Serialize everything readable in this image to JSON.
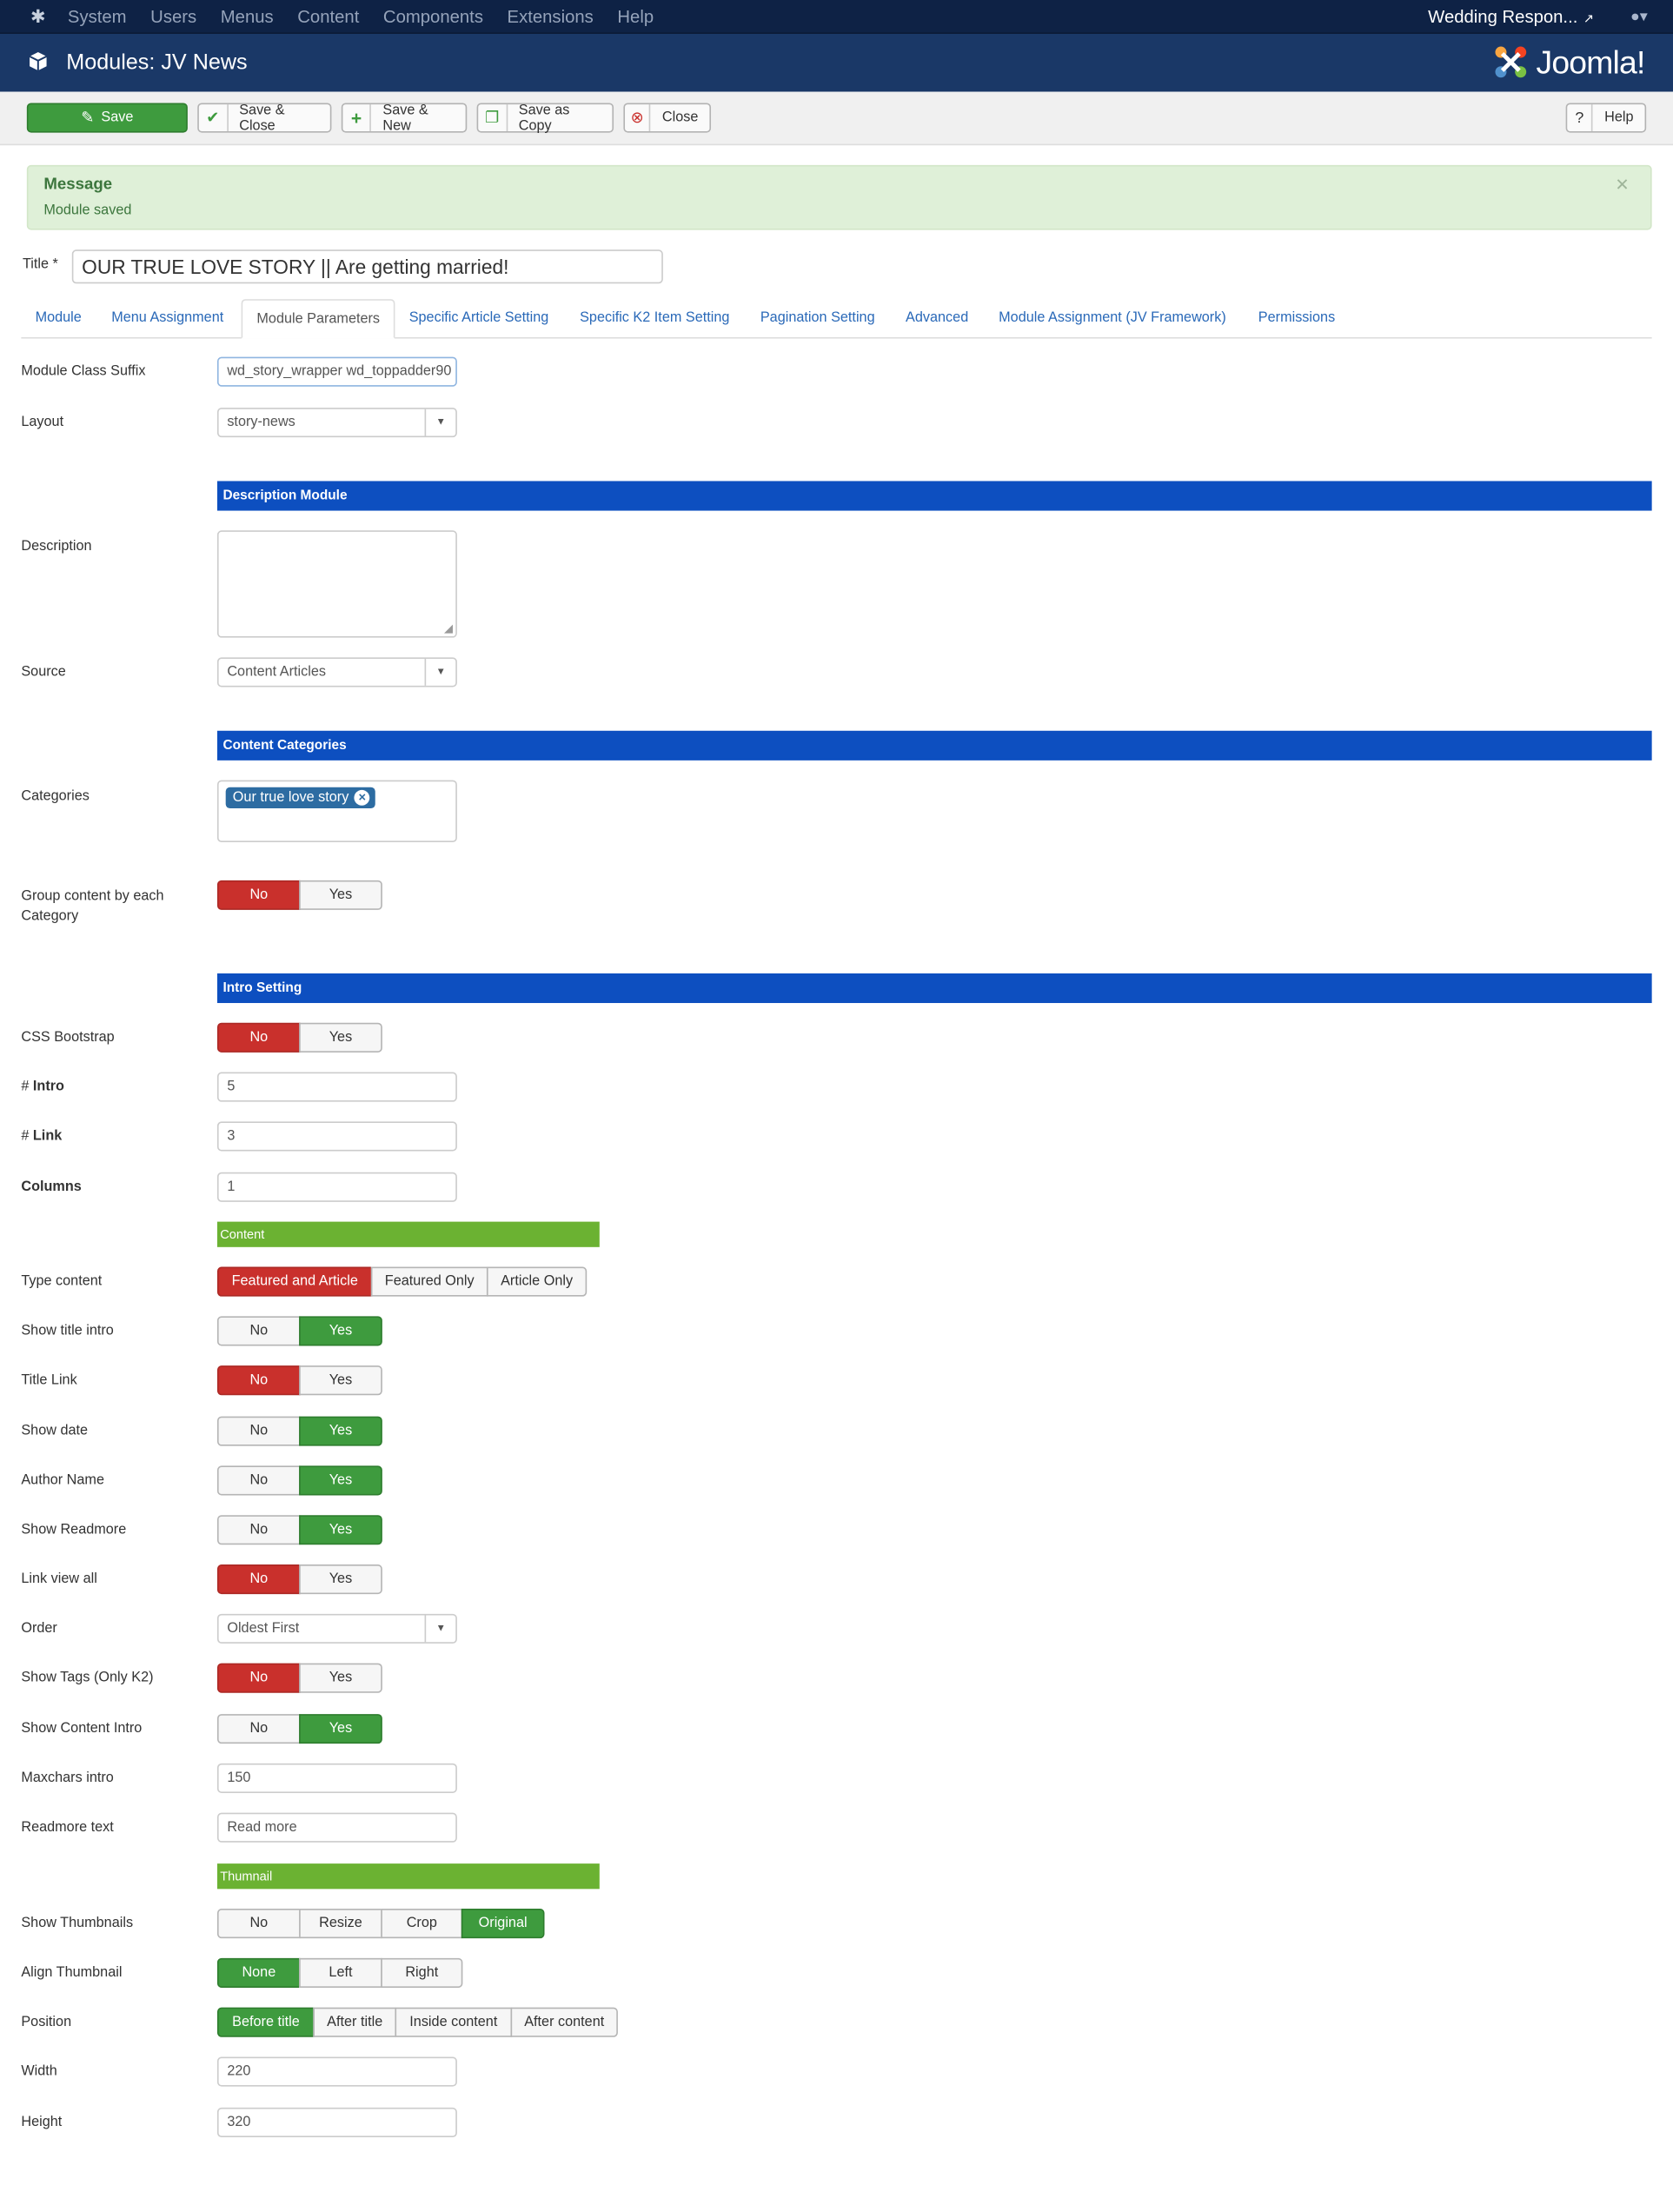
{
  "topnav": {
    "menu": [
      "System",
      "Users",
      "Menus",
      "Content",
      "Components",
      "Extensions",
      "Help"
    ],
    "site_name": "Wedding Respon...",
    "logo": "joomla-icon",
    "user_icon": "user-icon"
  },
  "header": {
    "title": "Modules: JV News",
    "brand": "Joomla!"
  },
  "toolbar": {
    "save": "Save",
    "save_close": "Save & Close",
    "save_new": "Save & New",
    "save_copy": "Save as Copy",
    "close": "Close",
    "help": "Help"
  },
  "message": {
    "heading": "Message",
    "text": "Module saved"
  },
  "title": {
    "label": "Title *",
    "value": "OUR TRUE LOVE STORY || Are getting married!"
  },
  "tabs": [
    "Module",
    "Menu Assignment",
    "Module Parameters",
    "Specific Article Setting",
    "Specific K2 Item Setting",
    "Pagination Setting",
    "Advanced",
    "Module Assignment (JV Framework)",
    "Permissions"
  ],
  "active_tab": "Module Parameters",
  "form": {
    "module_class_suffix": {
      "label": "Module Class Suffix",
      "value": "wd_story_wrapper wd_toppadder90"
    },
    "layout": {
      "label": "Layout",
      "value": "story-news"
    },
    "section_description": "Description Module",
    "description": {
      "label": "Description",
      "value": ""
    },
    "source": {
      "label": "Source",
      "value": "Content Articles"
    },
    "section_categories": "Content Categories",
    "categories": {
      "label": "Categories",
      "tag": "Our true love story"
    },
    "group_content": {
      "label": "Group content by each Category",
      "options": [
        "No",
        "Yes"
      ],
      "selected": "No"
    },
    "section_intro": "Intro Setting",
    "css_bootstrap": {
      "label": "CSS Bootstrap",
      "options": [
        "No",
        "Yes"
      ],
      "selected": "No"
    },
    "intro": {
      "prefix": "# ",
      "label": "Intro",
      "value": "5"
    },
    "link": {
      "prefix": "# ",
      "label": "Link",
      "value": "3"
    },
    "columns": {
      "label": "Columns",
      "value": "1"
    },
    "section_content": "Content",
    "type_content": {
      "label": "Type content",
      "options": [
        "Featured and Article",
        "Featured Only",
        "Article Only"
      ],
      "selected": "Featured and Article"
    },
    "show_title_intro": {
      "label": "Show title intro",
      "options": [
        "No",
        "Yes"
      ],
      "selected": "Yes"
    },
    "title_link": {
      "label": "Title Link",
      "options": [
        "No",
        "Yes"
      ],
      "selected": "No"
    },
    "show_date": {
      "label": "Show date",
      "options": [
        "No",
        "Yes"
      ],
      "selected": "Yes"
    },
    "author_name": {
      "label": "Author Name",
      "options": [
        "No",
        "Yes"
      ],
      "selected": "Yes"
    },
    "show_readmore": {
      "label": "Show Readmore",
      "options": [
        "No",
        "Yes"
      ],
      "selected": "Yes"
    },
    "link_view_all": {
      "label": "Link view all",
      "options": [
        "No",
        "Yes"
      ],
      "selected": "No"
    },
    "order": {
      "label": "Order",
      "value": "Oldest First"
    },
    "show_tags": {
      "label": "Show Tags (Only K2)",
      "options": [
        "No",
        "Yes"
      ],
      "selected": "No"
    },
    "show_content_intro": {
      "label": "Show Content Intro",
      "options": [
        "No",
        "Yes"
      ],
      "selected": "Yes"
    },
    "maxchars_intro": {
      "label": "Maxchars intro",
      "value": "150"
    },
    "readmore_text": {
      "label": "Readmore text",
      "value": "Read more"
    },
    "section_thumbnail": "Thumnail",
    "show_thumbnails": {
      "label": "Show Thumbnails",
      "options": [
        "No",
        "Resize",
        "Crop",
        "Original"
      ],
      "selected": "Original"
    },
    "align_thumbnail": {
      "label": "Align Thumbnail",
      "options": [
        "None",
        "Left",
        "Right"
      ],
      "selected": "None"
    },
    "position": {
      "label": "Position",
      "options": [
        "Before title",
        "After title",
        "Inside content",
        "After content"
      ],
      "selected": "Before title"
    },
    "width": {
      "label": "Width",
      "value": "220"
    },
    "height": {
      "label": "Height",
      "value": "320"
    }
  },
  "colors": {
    "topnav": "#0e2245",
    "header": "#1a3867",
    "save_green": "#3e9b3e",
    "no_red": "#c9302c",
    "section_blue": "#0d4fc0",
    "section_green": "#6bb232"
  }
}
